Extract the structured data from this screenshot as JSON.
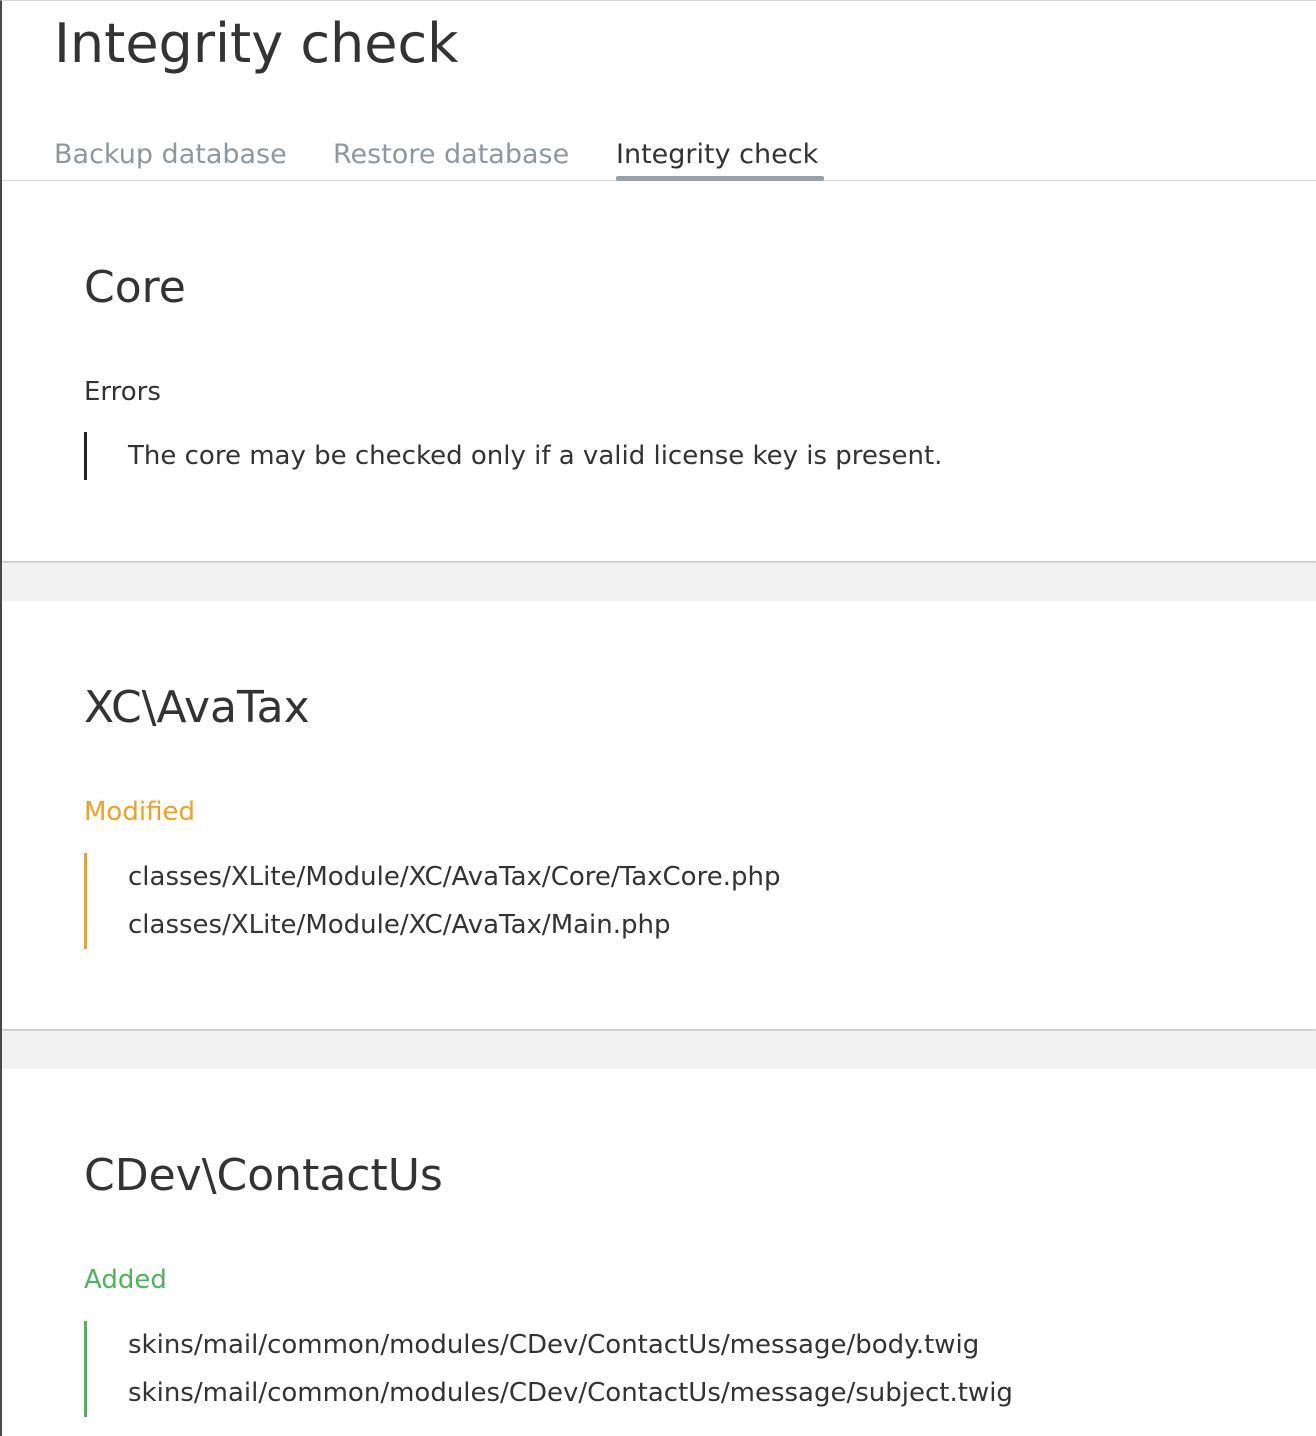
{
  "page": {
    "title": "Integrity check"
  },
  "tabs": [
    {
      "label": "Backup database",
      "active": false
    },
    {
      "label": "Restore database",
      "active": false
    },
    {
      "label": "Integrity check",
      "active": true
    }
  ],
  "sections": [
    {
      "title": "Core",
      "status": "Errors",
      "status_color": "#333333",
      "items": [
        "The core may be checked only if a valid license key is present."
      ]
    },
    {
      "title": "XC\\AvaTax",
      "status": "Modified",
      "status_color": "#f0a122",
      "items": [
        "classes/XLite/Module/XC/AvaTax/Core/TaxCore.php",
        "classes/XLite/Module/XC/AvaTax/Main.php"
      ]
    },
    {
      "title": "CDev\\ContactUs",
      "status": "Added",
      "status_color": "#4fb35b",
      "items": [
        "skins/mail/common/modules/CDev/ContactUs/message/body.twig",
        "skins/mail/common/modules/CDev/ContactUs/message/subject.twig"
      ]
    }
  ]
}
